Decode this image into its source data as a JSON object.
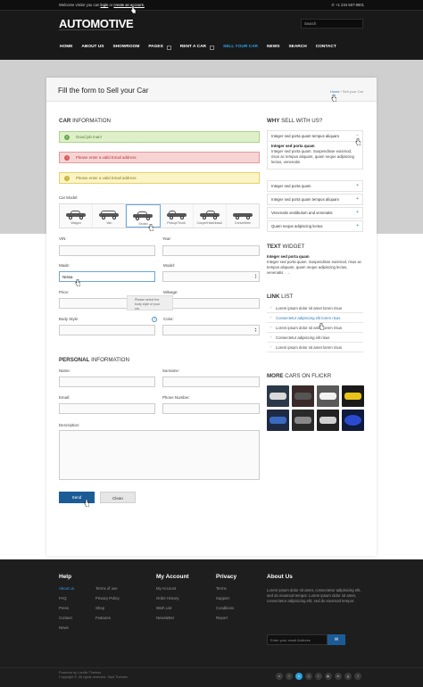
{
  "topbar": {
    "welcome_prefix": "Welcome visitor you can",
    "login_link": "login",
    "or_text": "or",
    "create_account_link": "create an account.",
    "phone": "+1 234 567-8901"
  },
  "header": {
    "logo": "AUTOMOTIVE",
    "search_placeholder": "Search",
    "nav": [
      "HOME",
      "ABOUT US",
      "SHOWROOM",
      "PAGES",
      "RENT A CAR",
      "SELL YOUR CAR",
      "NEWS",
      "SEARCH",
      "CONTACT"
    ],
    "active_nav": "SELL YOUR CAR",
    "accent_color": "#2aa3e0"
  },
  "page": {
    "title": "Fill the form to Sell your Car",
    "breadcrumb_home": "Home",
    "breadcrumb_sep": "/",
    "breadcrumb_current": "Sell your Car"
  },
  "car_info": {
    "heading_bold": "CAR",
    "heading_rest": " INFORMATION",
    "alerts": {
      "success": "Good job man!",
      "error": "Please enter a valid Email address",
      "warning": "Please enter a valid Email address"
    },
    "car_model_label": "Car Model:",
    "car_models": [
      "Wagon",
      "Van",
      "Sedan",
      "Pickup/Truck",
      "Coupe/Hatchback",
      "Convertible"
    ],
    "selected_model": "Sedan",
    "fields": {
      "vin_label": "VIN:",
      "year_label": "Year:",
      "made_label": "Made:",
      "made_value": "Nissa",
      "model_label": "Model:",
      "price_label": "Price:",
      "mileage_label": "Mileage:",
      "body_style_label": "Body Style:",
      "color_label": "Color:"
    },
    "tooltip": "Please select the body style of your car"
  },
  "personal_info": {
    "heading_bold": "PERSONAL",
    "heading_rest": " INFORMATION",
    "name_label": "Name:",
    "surname_label": "Surname:",
    "email_label": "Email:",
    "phone_label": "Phone Number:",
    "description_label": "Description:",
    "send_button": "Send",
    "clean_button": "Clean"
  },
  "sidebar": {
    "why_bold": "WHY",
    "why_rest": " SELL WITH US?",
    "accordion_open_title": "Integer sed porta quam tempus aliquam",
    "accordion_open_body_title": "Integer sed porta quam",
    "accordion_open_body": "Integer sed porta quam. Suspendisse euismod, risus ac tempus aliquam, quam neque adipiscing lectus, venenatis",
    "accordion_items": [
      "Integer sed porta quam",
      "Integer sed porta quam tempus aliquam",
      "Venenatis vestibulum and venenatis",
      "Quam neque adipiscing lectus"
    ],
    "text_widget_bold": "TEXT",
    "text_widget_rest": " WIDGET",
    "text_widget_title": "Integer sed porta quam",
    "text_widget_body": "Integer sed porta quam. Suspendisse euismod, risus ac tempus aliquam, quam neque adipiscing lectus, venenatis .",
    "text_widget_more": "→",
    "link_list_bold": "LINK",
    "link_list_rest": " LIST",
    "links": [
      "Lorem ipsum dolor sit amet lorem risus",
      "Consectetur adipiscing elit lorem risus",
      "Lorem ipsum dolor sit amet lorem risus",
      "Consectetur adipiscing elit risus",
      "Lorem ipsum dolor sit amet lorem risus"
    ],
    "active_link_index": 1,
    "flickr_bold": "MORE",
    "flickr_rest": " CARS ON FLICKR"
  },
  "footer": {
    "help_title": "Help",
    "help_col1": [
      "About us",
      "FAQ",
      "Press",
      "Contact",
      "News"
    ],
    "help_col2": [
      "Terms of use",
      "Privacy Policy",
      "Shop",
      "Features"
    ],
    "account_title": "My Account",
    "account_links": [
      "My Account",
      "Order History",
      "Wish List",
      "Newsletter"
    ],
    "privacy_title": "Privacy",
    "privacy_links": [
      "Terms",
      "Support",
      "Conditions",
      "Report"
    ],
    "about_title": "About Us",
    "about_text": "Lorem ipsum dolor sit amet, consectetur adipisicing elit, sed do eiusmod tempor. Lorem ipsum dolor sit amet, consectetur adipisicing elit, sed do eiusmod tempor.",
    "email_placeholder": "Enter your email Address",
    "subscribe_icon": "mail-icon",
    "copyright_line1": "Powered by Lorelle Themes",
    "copyright_line2": "Copyright ©, All rights reserved. Said Themes",
    "social_icons": [
      "skype-icon",
      "twitter-icon",
      "vimeo-icon",
      "dribbble-icon",
      "rss-icon",
      "youtube-icon",
      "linkedin-icon",
      "googleplus-icon",
      "facebook-icon"
    ]
  }
}
